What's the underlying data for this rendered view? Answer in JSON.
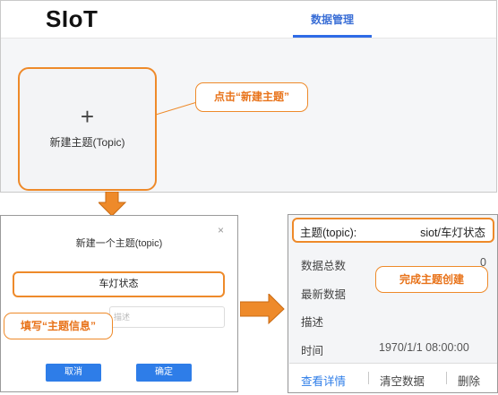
{
  "top": {
    "logo": "SIoT",
    "nav_tab": "数据管理",
    "new_card": {
      "plus": "+",
      "label": "新建主题(Topic)"
    },
    "callout": "点击“新建主题”"
  },
  "dialog": {
    "title": "新建一个主题(topic)",
    "close": "×",
    "topic_value": "车灯状态",
    "desc_placeholder": "描述",
    "cancel": "取消",
    "confirm": "确定",
    "callout": "填写“主题信息”"
  },
  "detail": {
    "topic_key": "主题(topic):",
    "topic_value": "siot/车灯状态",
    "total_label": "数据总数",
    "total_value": "0",
    "latest_label": "最新数据",
    "desc_label": "描述",
    "time_label": "时间",
    "time_value": "1970/1/1 08:00:00",
    "callout": "完成主题创建",
    "footer": {
      "view": "查看详情",
      "clear": "清空数据",
      "delete": "删除"
    }
  },
  "colors": {
    "accent_orange": "#ee8a2a",
    "primary_blue": "#2e7de8",
    "panel_bg": "#f5f6f8"
  }
}
